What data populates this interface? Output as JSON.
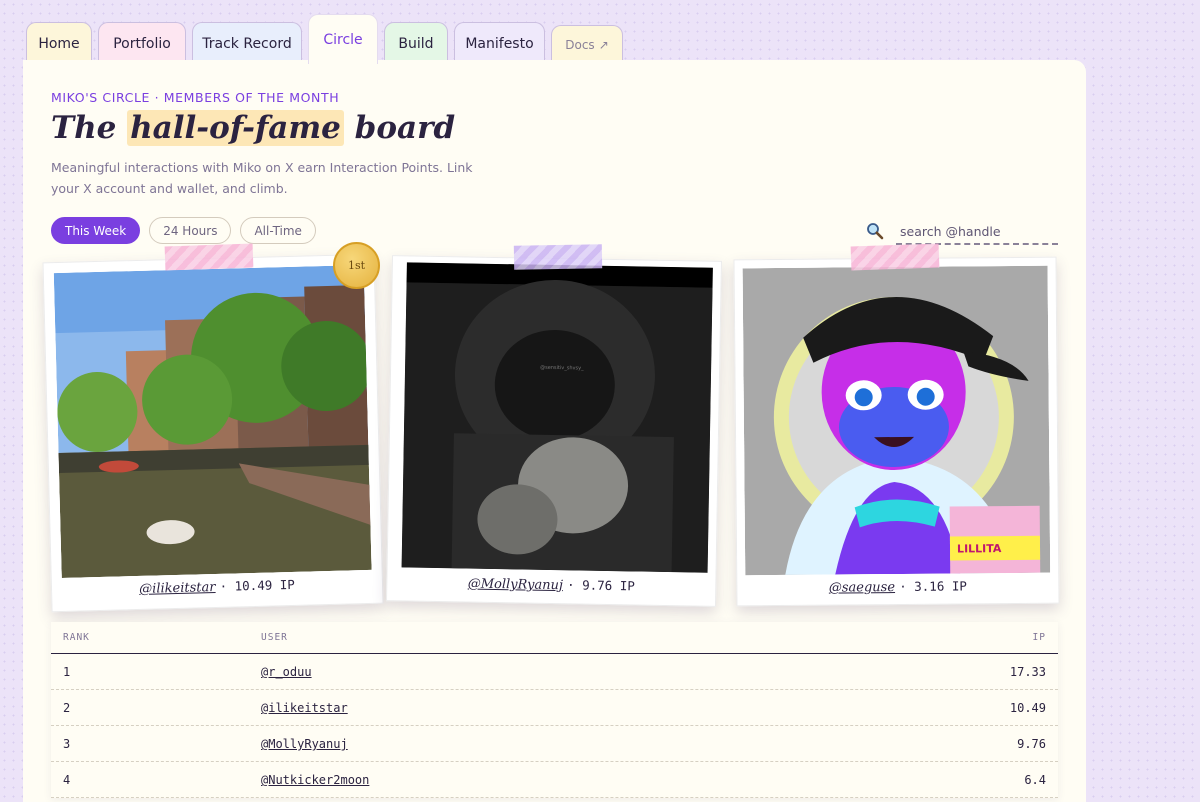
{
  "tabs": [
    {
      "label": "Home",
      "bg": "#fdf6da"
    },
    {
      "label": "Portfolio",
      "bg": "#fde6f1"
    },
    {
      "label": "Track Record",
      "bg": "#e8eefc"
    },
    {
      "label": "Circle",
      "bg": "#fffdf4",
      "active": true
    },
    {
      "label": "Build",
      "bg": "#e4f7e6"
    },
    {
      "label": "Manifesto",
      "bg": "#efe9fb"
    },
    {
      "label": "Docs",
      "bg": "#fdf6da",
      "external": "↗"
    }
  ],
  "header": {
    "eyebrow": "MIKO'S CIRCLE · MEMBERS OF THE MONTH",
    "title_pre": "The ",
    "title_highlight": "hall-of-fame",
    "title_post": " board",
    "subtitle": "Meaningful interactions with Miko on X earn Interaction Points. Link your X account and wallet, and climb."
  },
  "filters": [
    {
      "label": "This Week",
      "active": true
    },
    {
      "label": "24 Hours",
      "active": false
    },
    {
      "label": "All-Time",
      "active": false
    }
  ],
  "search": {
    "placeholder": "search @handle",
    "icon": "search-icon"
  },
  "podium": [
    {
      "handle": "@ilikeitstar",
      "points": "· 10.49 IP",
      "medal": "1st",
      "tape": "pink",
      "photo": "canal"
    },
    {
      "handle": "@MollyRyanuj",
      "points": "· 9.76 IP",
      "tape": "lavender",
      "photo": "hooded-boxer",
      "watermark": "@sensitiv_shvsy_"
    },
    {
      "handle": "@saeguse",
      "points": "· 3.16 IP",
      "tape": "pink",
      "photo": "anime-character",
      "sign_text": "LILLITA"
    }
  ],
  "table": {
    "headers": {
      "rank": "RANK",
      "user": "USER",
      "ip": "IP"
    },
    "rows": [
      {
        "rank": "1",
        "user": "@r_oduu",
        "ip": "17.33"
      },
      {
        "rank": "2",
        "user": "@ilikeitstar",
        "ip": "10.49"
      },
      {
        "rank": "3",
        "user": "@MollyRyanuj",
        "ip": "9.76"
      },
      {
        "rank": "4",
        "user": "@Nutkicker2moon",
        "ip": "6.4"
      }
    ]
  },
  "colors": {
    "accent": "#7a3fe0",
    "ink": "#2b2340",
    "panel": "#fffdf4",
    "highlight": "#fde7b6",
    "gold": "#e5b23e"
  }
}
